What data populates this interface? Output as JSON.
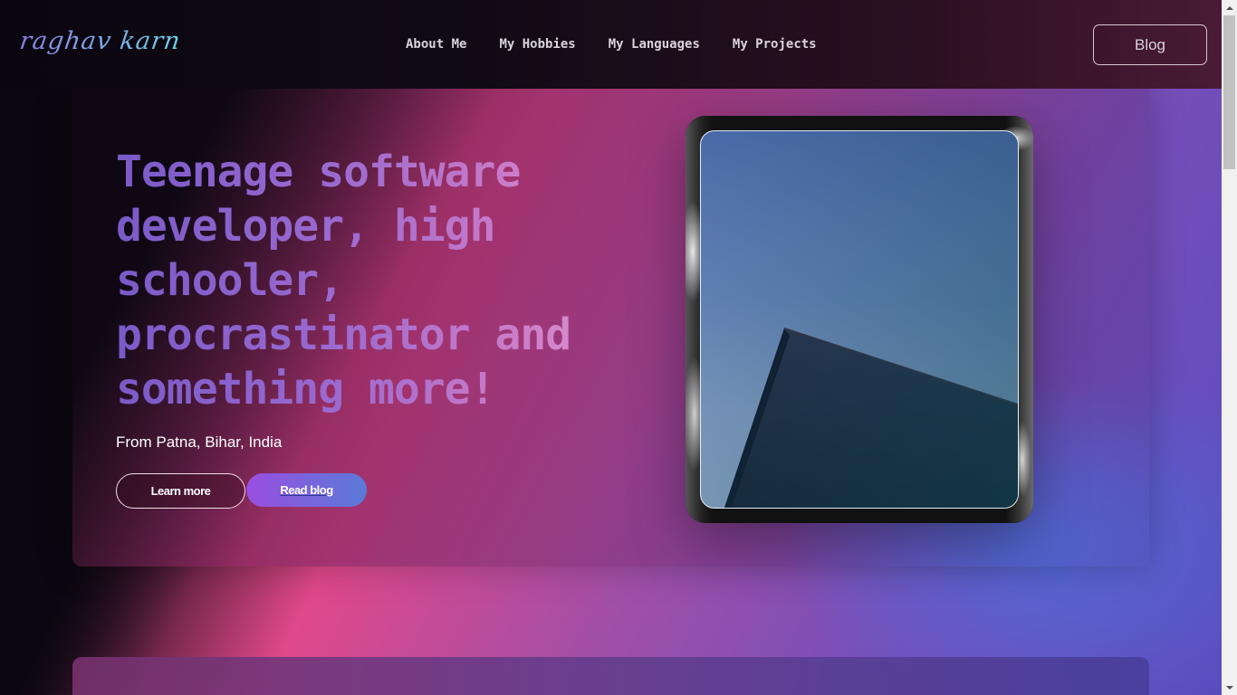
{
  "nav": {
    "logo": "raghav karn",
    "links": [
      {
        "label": "About Me"
      },
      {
        "label": "My Hobbies"
      },
      {
        "label": "My Languages"
      },
      {
        "label": "My Projects"
      }
    ],
    "cta_label": "Blog"
  },
  "hero": {
    "headline": "Teenage software developer, high schooler, procrastinator and something more!",
    "subtitle": "From Patna, Bihar, India",
    "primary_button": "Learn more",
    "secondary_button": "Read blog"
  },
  "colors": {
    "accent_pink": "#e0488a",
    "accent_purple": "#9a4ee0",
    "accent_blue": "#5a7ad8",
    "headline_start": "#7a5ac8",
    "headline_end": "#e79ad0"
  },
  "icons": {
    "photo": "building-sky-photo"
  }
}
